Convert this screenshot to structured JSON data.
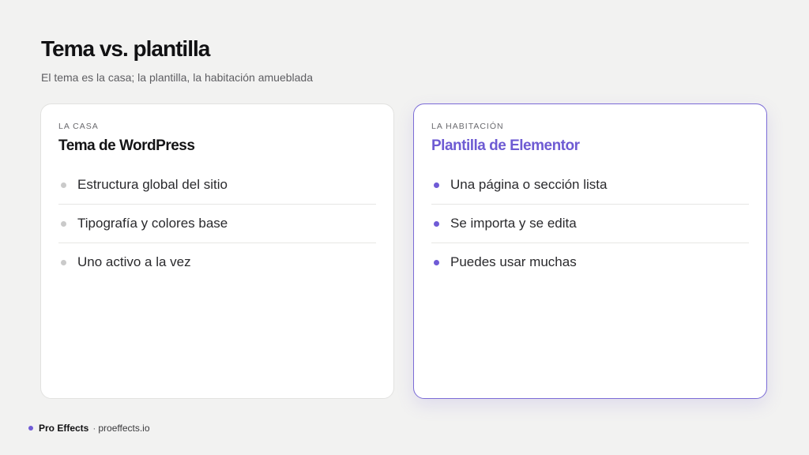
{
  "header": {
    "title": "Tema vs. plantilla",
    "subtitle": "El tema es la casa; la plantilla, la habitación amueblada"
  },
  "cards": [
    {
      "eyebrow": "LA CASA",
      "title": "Tema de WordPress",
      "items": [
        "Estructura global del sitio",
        "Tipografía y colores base",
        "Uno activo a la vez"
      ]
    },
    {
      "eyebrow": "LA HABITACIÓN",
      "title": "Plantilla de Elementor",
      "items": [
        "Una página o sección lista",
        "Se importa y se edita",
        "Puedes usar muchas"
      ]
    }
  ],
  "footer": {
    "brand": "Pro Effects",
    "separator": "·",
    "url": "proeffects.io"
  },
  "colors": {
    "background": "#f2f2f1",
    "accent": "#6f5bd6",
    "neutral_bullet": "#cacaca"
  }
}
